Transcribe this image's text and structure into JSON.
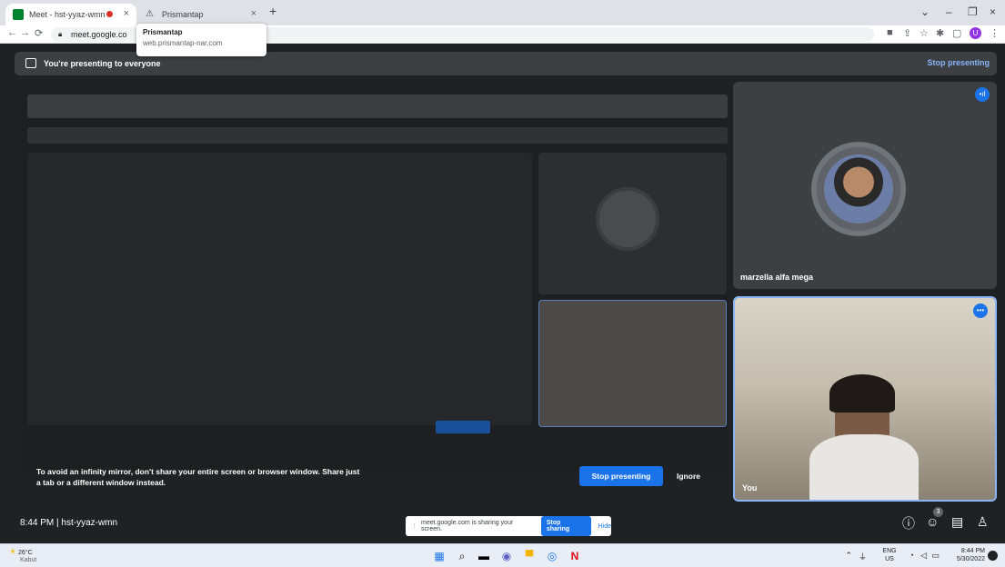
{
  "browser": {
    "tabs": [
      {
        "label": "Meet - hst-yyaz-wmn",
        "close": "×"
      },
      {
        "label": "Prismantap",
        "close": "×"
      }
    ],
    "new_tab": "+",
    "address": "meet.google.co",
    "tooltip": {
      "title": "Prismantap",
      "url": "web.prismantap-nar.com"
    },
    "window_controls": [
      "⌄",
      "–",
      "❐",
      "×"
    ]
  },
  "meet": {
    "presenting_banner": "You're presenting to everyone",
    "stop_presenting_top": "Stop presenting",
    "mirror_warning": "To avoid an infinity mirror, don't share your entire screen or browser window. Share just a tab or a different window instead.",
    "stop_presenting_button": "Stop presenting",
    "ignore_button": "Ignore",
    "participants": [
      {
        "name": "marzella alfa mega"
      },
      {
        "name": "You"
      }
    ],
    "meeting_info": "8:44 PM  |  hst-yyaz-wmn",
    "share_notice": {
      "text": "meet.google.com is sharing your screen.",
      "stop_sharing": "Stop sharing",
      "hide": "Hide"
    },
    "people_count": "3"
  },
  "taskbar": {
    "weather_temp": "26°C",
    "weather_desc": "Kabut",
    "lang": "ENG",
    "region": "US",
    "time": "8:44 PM",
    "date": "5/30/2022"
  },
  "colors": {
    "accent": "#1a73e8",
    "link": "#8ab4f8",
    "meet_bg": "#202124",
    "tile_bg": "#3c4043"
  }
}
